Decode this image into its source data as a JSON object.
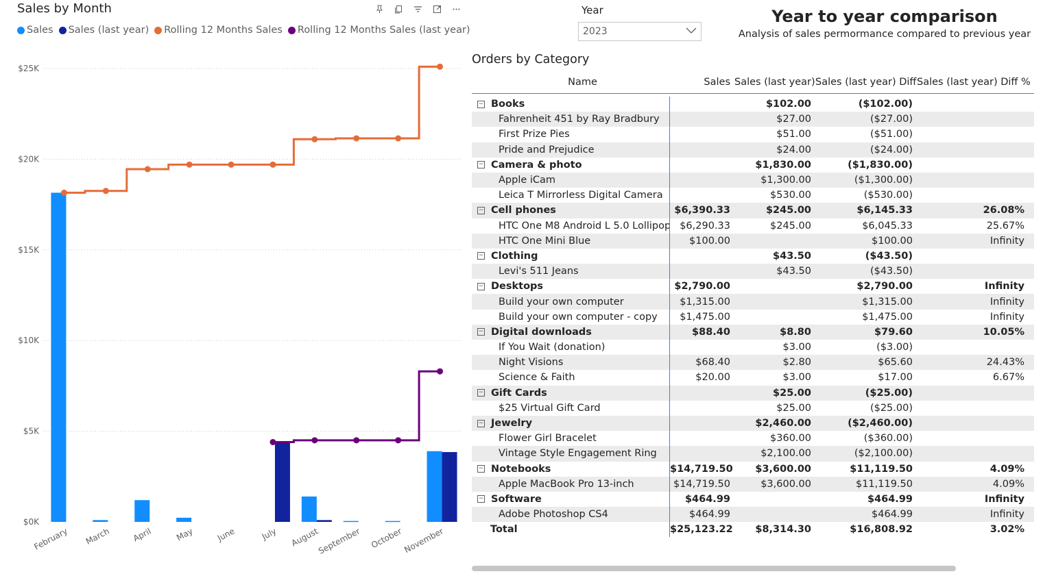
{
  "chart": {
    "title": "Sales by Month",
    "header_icons": [
      "pin-icon",
      "copy-icon",
      "filter-icon",
      "focus-mode-icon",
      "more-options-icon"
    ],
    "legend": [
      {
        "label": "Sales",
        "color": "#118dff"
      },
      {
        "label": "Sales (last year)",
        "color": "#12239e"
      },
      {
        "label": "Rolling 12 Months Sales",
        "color": "#e66c37"
      },
      {
        "label": "Rolling 12 Months Sales (last year)",
        "color": "#6b007b"
      }
    ]
  },
  "chart_data": {
    "type": "bar",
    "title": "Sales by Month",
    "categories": [
      "February",
      "March",
      "April",
      "May",
      "June",
      "July",
      "August",
      "September",
      "October",
      "November"
    ],
    "y_ticks": [
      "$0K",
      "$5K",
      "$10K",
      "$15K",
      "$20K",
      "$25K"
    ],
    "ylim": [
      0,
      25000
    ],
    "grid": true,
    "legend_position": "top-left",
    "series": [
      {
        "name": "Sales",
        "kind": "bar",
        "color": "#118dff",
        "values": [
          18150,
          100,
          1200,
          230,
          0,
          0,
          1400,
          50,
          50,
          3900
        ]
      },
      {
        "name": "Sales (last year)",
        "kind": "bar",
        "color": "#12239e",
        "values": [
          0,
          0,
          0,
          0,
          0,
          4400,
          100,
          0,
          0,
          3850
        ]
      },
      {
        "name": "Rolling 12 Months Sales",
        "kind": "step-line",
        "color": "#e66c37",
        "values": [
          18150,
          18250,
          19450,
          19700,
          19700,
          19700,
          21100,
          21150,
          21150,
          25100
        ]
      },
      {
        "name": "Rolling 12 Months Sales (last year)",
        "kind": "step-line",
        "color": "#6b007b",
        "values": [
          null,
          null,
          null,
          null,
          null,
          4400,
          4500,
          4500,
          4500,
          8300
        ]
      }
    ]
  },
  "slicer": {
    "label": "Year",
    "value": "2023"
  },
  "header": {
    "title": "Year to year comparison",
    "subtitle": "Analysis of sales permormance compared to previous year"
  },
  "matrix": {
    "title": "Orders by Category",
    "columns": [
      "Name",
      "Sales",
      "Sales (last year)",
      "Sales (last year) Diff",
      "Sales (last year) Diff %"
    ],
    "rows": [
      {
        "type": "cat",
        "name": "Books",
        "sales": "",
        "last": "$102.00",
        "diff": "($102.00)",
        "pct": ""
      },
      {
        "type": "item",
        "name": "Fahrenheit 451 by Ray Bradbury",
        "sales": "",
        "last": "$27.00",
        "diff": "($27.00)",
        "pct": ""
      },
      {
        "type": "item",
        "name": "First Prize Pies",
        "sales": "",
        "last": "$51.00",
        "diff": "($51.00)",
        "pct": ""
      },
      {
        "type": "item",
        "name": "Pride and Prejudice",
        "sales": "",
        "last": "$24.00",
        "diff": "($24.00)",
        "pct": ""
      },
      {
        "type": "cat",
        "name": "Camera & photo",
        "sales": "",
        "last": "$1,830.00",
        "diff": "($1,830.00)",
        "pct": ""
      },
      {
        "type": "item",
        "name": "Apple iCam",
        "sales": "",
        "last": "$1,300.00",
        "diff": "($1,300.00)",
        "pct": ""
      },
      {
        "type": "item",
        "name": "Leica T Mirrorless Digital Camera",
        "sales": "",
        "last": "$530.00",
        "diff": "($530.00)",
        "pct": ""
      },
      {
        "type": "cat",
        "name": "Cell phones",
        "sales": "$6,390.33",
        "last": "$245.00",
        "diff": "$6,145.33",
        "pct": "26.08%"
      },
      {
        "type": "item",
        "name": "HTC One M8 Android L 5.0 Lollipop",
        "sales": "$6,290.33",
        "last": "$245.00",
        "diff": "$6,045.33",
        "pct": "25.67%"
      },
      {
        "type": "item",
        "name": "HTC One Mini Blue",
        "sales": "$100.00",
        "last": "",
        "diff": "$100.00",
        "pct": "Infinity"
      },
      {
        "type": "cat",
        "name": "Clothing",
        "sales": "",
        "last": "$43.50",
        "diff": "($43.50)",
        "pct": ""
      },
      {
        "type": "item",
        "name": "Levi's 511 Jeans",
        "sales": "",
        "last": "$43.50",
        "diff": "($43.50)",
        "pct": ""
      },
      {
        "type": "cat",
        "name": "Desktops",
        "sales": "$2,790.00",
        "last": "",
        "diff": "$2,790.00",
        "pct": "Infinity"
      },
      {
        "type": "item",
        "name": "Build your own computer",
        "sales": "$1,315.00",
        "last": "",
        "diff": "$1,315.00",
        "pct": "Infinity"
      },
      {
        "type": "item",
        "name": "Build your own computer - copy",
        "sales": "$1,475.00",
        "last": "",
        "diff": "$1,475.00",
        "pct": "Infinity"
      },
      {
        "type": "cat",
        "name": "Digital downloads",
        "sales": "$88.40",
        "last": "$8.80",
        "diff": "$79.60",
        "pct": "10.05%"
      },
      {
        "type": "item",
        "name": "If You Wait (donation)",
        "sales": "",
        "last": "$3.00",
        "diff": "($3.00)",
        "pct": ""
      },
      {
        "type": "item",
        "name": "Night Visions",
        "sales": "$68.40",
        "last": "$2.80",
        "diff": "$65.60",
        "pct": "24.43%"
      },
      {
        "type": "item",
        "name": "Science & Faith",
        "sales": "$20.00",
        "last": "$3.00",
        "diff": "$17.00",
        "pct": "6.67%"
      },
      {
        "type": "cat",
        "name": "Gift Cards",
        "sales": "",
        "last": "$25.00",
        "diff": "($25.00)",
        "pct": ""
      },
      {
        "type": "item",
        "name": "$25 Virtual Gift Card",
        "sales": "",
        "last": "$25.00",
        "diff": "($25.00)",
        "pct": ""
      },
      {
        "type": "cat",
        "name": "Jewelry",
        "sales": "",
        "last": "$2,460.00",
        "diff": "($2,460.00)",
        "pct": ""
      },
      {
        "type": "item",
        "name": "Flower Girl Bracelet",
        "sales": "",
        "last": "$360.00",
        "diff": "($360.00)",
        "pct": ""
      },
      {
        "type": "item",
        "name": "Vintage Style Engagement Ring",
        "sales": "",
        "last": "$2,100.00",
        "diff": "($2,100.00)",
        "pct": ""
      },
      {
        "type": "cat",
        "name": "Notebooks",
        "sales": "$14,719.50",
        "last": "$3,600.00",
        "diff": "$11,119.50",
        "pct": "4.09%"
      },
      {
        "type": "item",
        "name": "Apple MacBook Pro 13-inch",
        "sales": "$14,719.50",
        "last": "$3,600.00",
        "diff": "$11,119.50",
        "pct": "4.09%"
      },
      {
        "type": "cat",
        "name": "Software",
        "sales": "$464.99",
        "last": "",
        "diff": "$464.99",
        "pct": "Infinity"
      },
      {
        "type": "item",
        "name": "Adobe Photoshop CS4",
        "sales": "$464.99",
        "last": "",
        "diff": "$464.99",
        "pct": "Infinity"
      }
    ],
    "total": {
      "name": "Total",
      "sales": "$25,123.22",
      "last": "$8,314.30",
      "diff": "$16,808.92",
      "pct": "3.02%"
    }
  }
}
